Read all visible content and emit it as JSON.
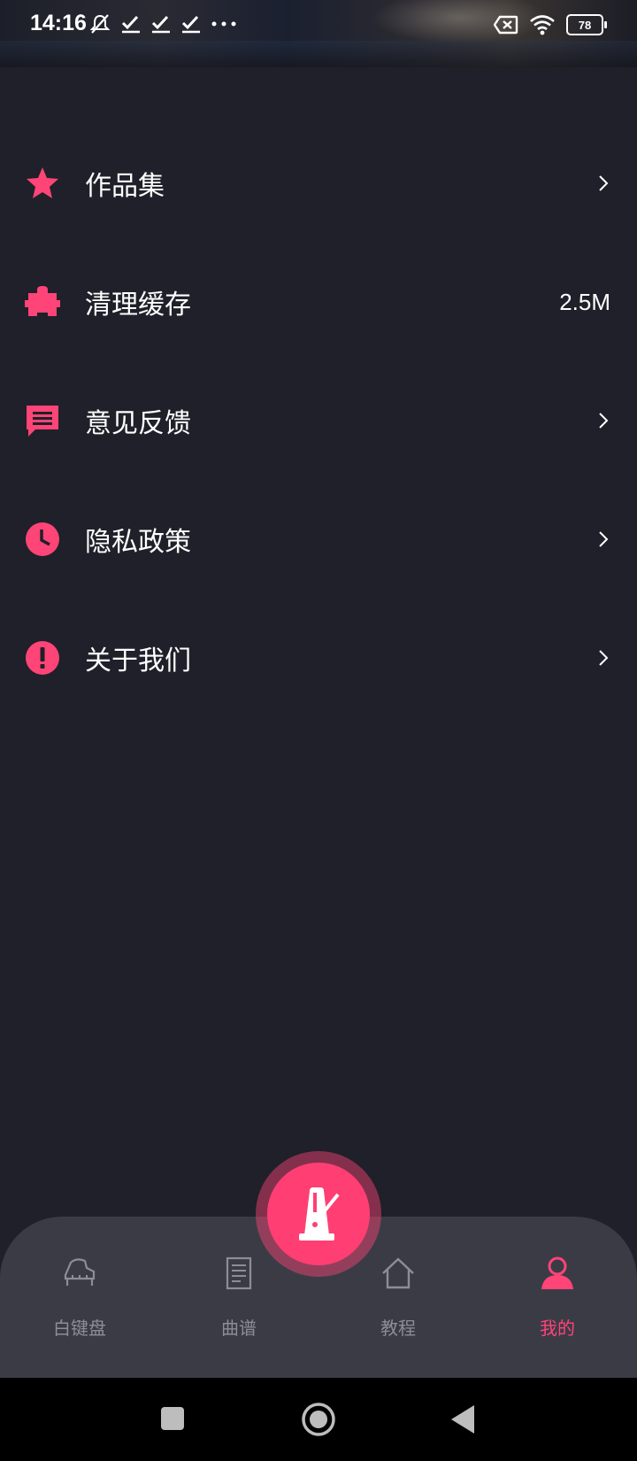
{
  "status_bar": {
    "time": "14:16",
    "battery": "78",
    "left_icons": [
      "mute-icon",
      "check-icon",
      "check-icon",
      "check-icon",
      "more-dots-icon"
    ],
    "right_icons": [
      "sim-off-icon",
      "wifi-icon",
      "battery-icon"
    ]
  },
  "menu": {
    "items": [
      {
        "label": "作品集",
        "icon": "star-icon",
        "trailing": "chevron"
      },
      {
        "label": "清理缓存",
        "icon": "puzzle-icon",
        "trailing": "value",
        "value": "2.5M"
      },
      {
        "label": "意见反馈",
        "icon": "chat-icon",
        "trailing": "chevron"
      },
      {
        "label": "隐私政策",
        "icon": "clock-icon",
        "trailing": "chevron"
      },
      {
        "label": "关于我们",
        "icon": "alert-icon",
        "trailing": "chevron"
      }
    ]
  },
  "bottom_nav": {
    "items": [
      {
        "label": "白键盘",
        "icon": "piano-icon",
        "active": false
      },
      {
        "label": "曲谱",
        "icon": "sheet-icon",
        "active": false
      },
      {
        "label": "教程",
        "icon": "home-icon",
        "active": false
      },
      {
        "label": "我的",
        "icon": "person-icon",
        "active": true
      }
    ],
    "center_button_icon": "metronome-icon"
  },
  "colors": {
    "background": "#1f2029",
    "accent": "#ff4477",
    "nav_background": "#3b3b46",
    "inactive_label": "#8d8d96"
  },
  "system_nav": [
    "recents-square-icon",
    "home-circle-icon",
    "back-triangle-icon"
  ]
}
